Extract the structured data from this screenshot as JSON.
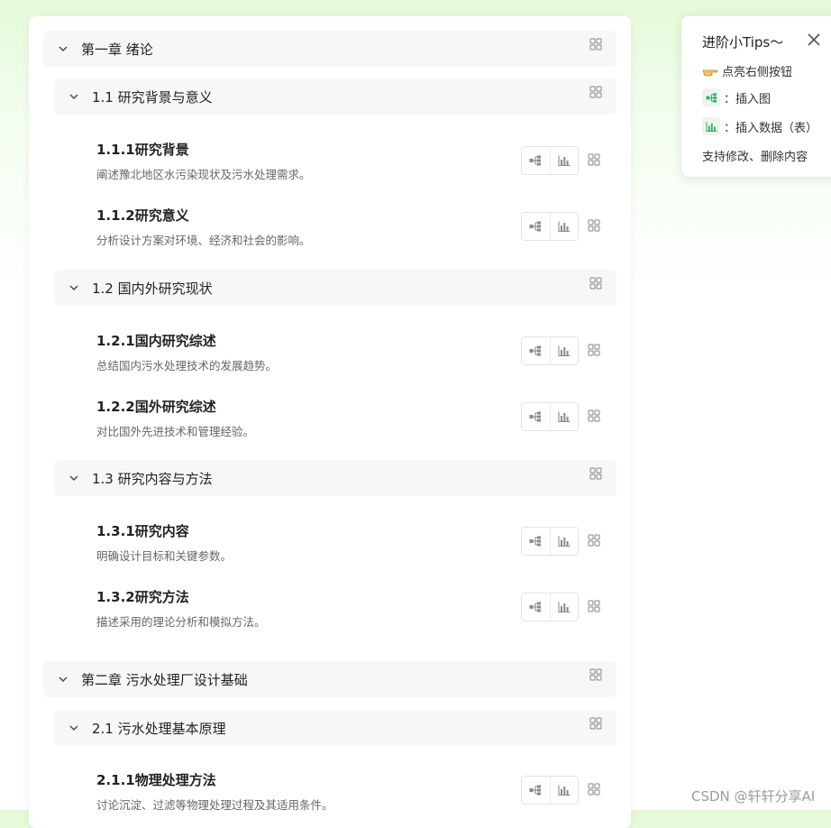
{
  "outline": {
    "chapters": [
      {
        "label": "第一章 绪论"
      },
      {
        "label": "第二章 污水处理厂设计基础"
      }
    ],
    "sections": [
      {
        "label": "1.1 研究背景与意义"
      },
      {
        "label": "1.2 国内外研究现状"
      },
      {
        "label": "1.3 研究内容与方法"
      },
      {
        "label": "2.1 污水处理基本原理"
      }
    ],
    "items": [
      {
        "title": "1.1.1研究背景",
        "desc": "阐述豫北地区水污染现状及污水处理需求。"
      },
      {
        "title": "1.1.2研究意义",
        "desc": "分析设计方案对环境、经济和社会的影响。"
      },
      {
        "title": "1.2.1国内研究综述",
        "desc": "总结国内污水处理技术的发展趋势。"
      },
      {
        "title": "1.2.2国外研究综述",
        "desc": "对比国外先进技术和管理经验。"
      },
      {
        "title": "1.3.1研究内容",
        "desc": "明确设计目标和关键参数。"
      },
      {
        "title": "1.3.2研究方法",
        "desc": "描述采用的理论分析和模拟方法。"
      },
      {
        "title": "2.1.1物理处理方法",
        "desc": "讨论沉淀、过滤等物理处理过程及其适用条件。"
      }
    ]
  },
  "tips": {
    "title": "进阶小Tips～",
    "row1": "点亮右侧按钮",
    "row2": "：插入图",
    "row3": "：插入数据（表）",
    "row4": "支持修改、删除内容"
  },
  "watermark": "CSDN @轩轩分享AI",
  "colors": {
    "accent": "#27b069",
    "icon_gray": "#8a8a8a",
    "head_bg": "#f7f7f7"
  },
  "icons": {
    "chevron": "chevron-down-icon",
    "grid": "grid-icon",
    "tree": "mindmap-icon",
    "bar": "bar-chart-icon",
    "close": "close-icon",
    "hand": "pointing-hand-icon"
  }
}
